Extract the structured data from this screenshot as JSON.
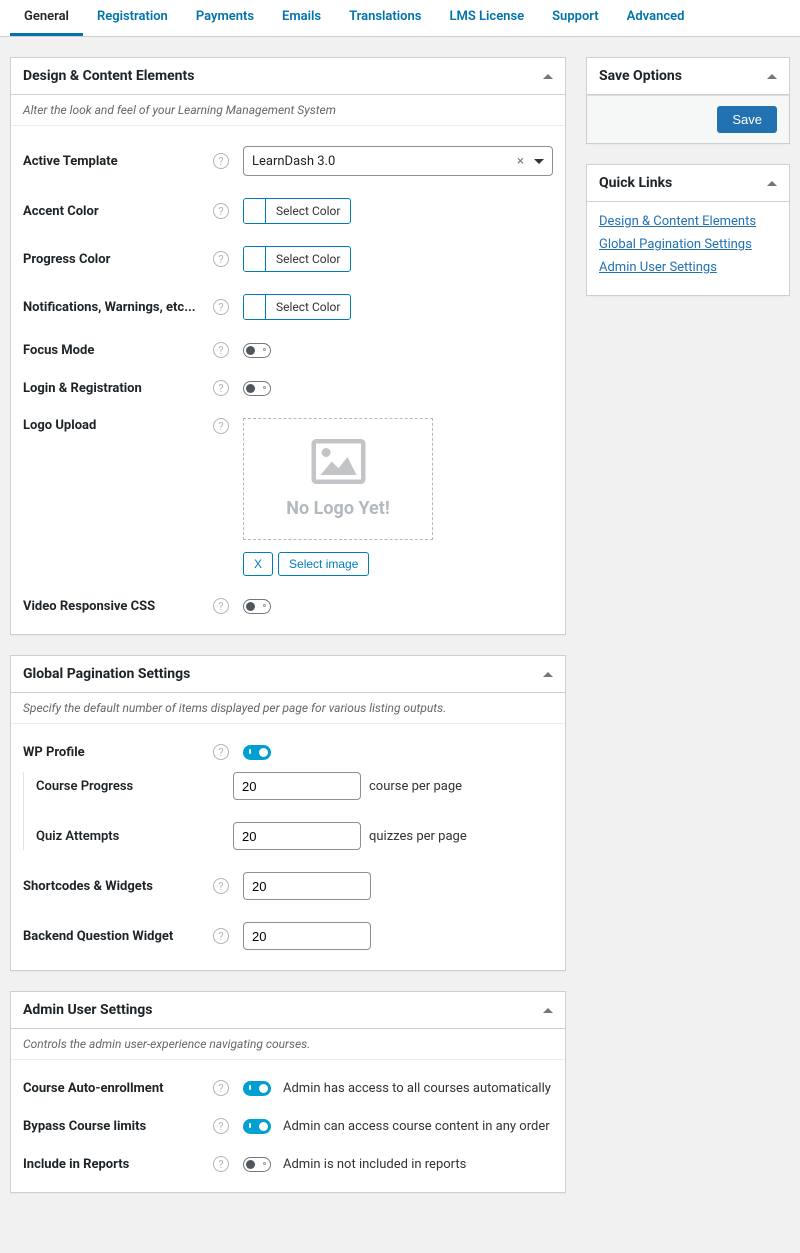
{
  "tabs": [
    "General",
    "Registration",
    "Payments",
    "Emails",
    "Translations",
    "LMS License",
    "Support",
    "Advanced"
  ],
  "design": {
    "title": "Design & Content Elements",
    "desc": "Alter the look and feel of your Learning Management System",
    "labels": {
      "template": "Active Template",
      "accent": "Accent Color",
      "progress": "Progress Color",
      "notify": "Notifications, Warnings, etc...",
      "focus": "Focus Mode",
      "login": "Login & Registration",
      "logo": "Logo Upload",
      "video": "Video Responsive CSS"
    },
    "template_value": "LearnDash 3.0",
    "select_color": "Select Color",
    "no_logo": "No Logo Yet!",
    "x": "X",
    "select_image": "Select image"
  },
  "pagination": {
    "title": "Global Pagination Settings",
    "desc": "Specify the default number of items displayed per page for various listing outputs.",
    "labels": {
      "wp": "WP Profile",
      "course": "Course Progress",
      "quiz": "Quiz Attempts",
      "short": "Shortcodes & Widgets",
      "backend": "Backend Question Widget"
    },
    "values": {
      "course": "20",
      "quiz": "20",
      "short": "20",
      "backend": "20"
    },
    "suffix": {
      "course": "course per page",
      "quiz": "quizzes per page"
    }
  },
  "admin": {
    "title": "Admin User Settings",
    "desc": "Controls the admin user-experience navigating courses.",
    "labels": {
      "auto": "Course Auto-enrollment",
      "bypass": "Bypass Course limits",
      "reports": "Include in Reports"
    },
    "texts": {
      "auto": "Admin has access to all courses automatically",
      "bypass": "Admin can access course content in any order",
      "reports": "Admin is not included in reports"
    }
  },
  "side": {
    "save_title": "Save Options",
    "save_btn": "Save",
    "quick_title": "Quick Links",
    "links": {
      "design": "Design & Content Elements",
      "pagination": "Global Pagination Settings",
      "admin": "Admin User Settings"
    }
  }
}
